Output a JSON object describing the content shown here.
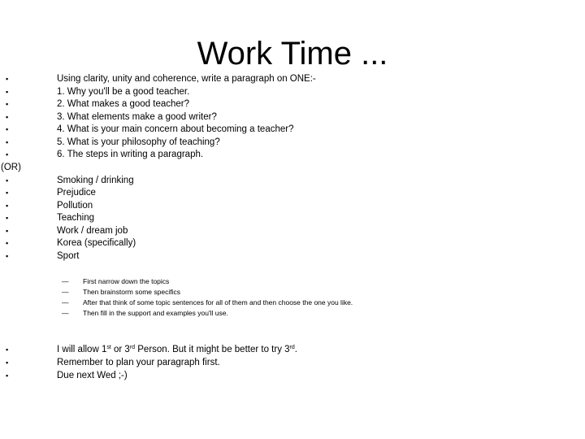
{
  "slide": {
    "title": "Work Time ...",
    "intro": "Using clarity, unity and coherence, write a paragraph on ONE:-",
    "questions": [
      "1. Why you'll be a good teacher.",
      "2. What makes a good teacher?",
      "3. What elements make a good writer?",
      "4. What is your main concern about becoming a teacher?",
      "5. What is your philosophy of teaching?",
      "6. The steps in writing a paragraph."
    ],
    "or_label": "(OR)",
    "topics": [
      "Smoking / drinking",
      "Prejudice",
      "Pollution",
      "Teaching",
      "Work / dream job",
      "Korea (specifically)",
      "Sport"
    ],
    "steps": [
      "First narrow down the topics",
      "Then brainstorm some specifics",
      "After that think of some topic sentences for all of them and then choose the one you like.",
      "Then fill in the support and examples you'll use."
    ],
    "notes": {
      "person": {
        "part1": "I will allow 1",
        "sup1": "st",
        "part2": " or 3",
        "sup2": "rd",
        "part3": " Person. But it might be better to try 3",
        "sup3": "rd",
        "part4": "."
      },
      "plan": "Remember to plan your paragraph first.",
      "due": "Due next Wed ;-)"
    },
    "bullet_glyph": "▪",
    "dash_glyph": "—"
  }
}
